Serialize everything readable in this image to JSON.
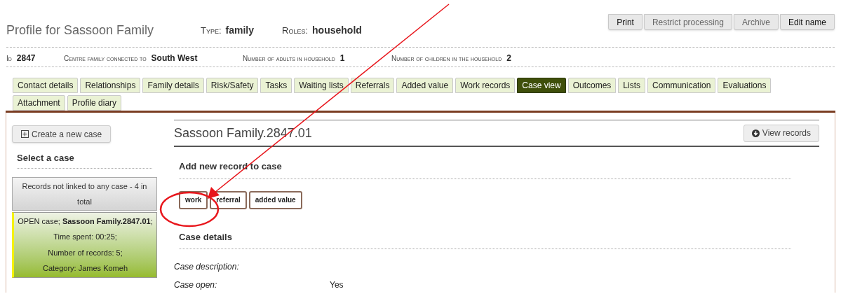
{
  "header": {
    "title": "Profile for Sassoon Family",
    "fields": [
      {
        "label": "Type:",
        "value": "family"
      },
      {
        "label": "Roles:",
        "value": "household"
      }
    ],
    "buttons": [
      {
        "label": "Print",
        "dark": true
      },
      {
        "label": "Restrict processing",
        "dark": false
      },
      {
        "label": "Archive",
        "dark": false
      },
      {
        "label": "Edit name",
        "dark": true
      }
    ]
  },
  "info": [
    {
      "label": "Id",
      "value": "2847"
    },
    {
      "label": "Centre family connected to",
      "value": "South West"
    },
    {
      "label": "Number of adults in household",
      "value": "1"
    },
    {
      "label": "Number of children in the household",
      "value": "2"
    }
  ],
  "tabs": [
    [
      {
        "label": "Contact details",
        "selected": false
      },
      {
        "label": "Relationships",
        "selected": false
      },
      {
        "label": "Family details",
        "selected": false
      },
      {
        "label": "Risk/Safety",
        "selected": false
      },
      {
        "label": "Tasks",
        "selected": false
      },
      {
        "label": "Waiting lists",
        "selected": false
      },
      {
        "label": "Referrals",
        "selected": false
      },
      {
        "label": "Added value",
        "selected": false
      },
      {
        "label": "Work records",
        "selected": false
      },
      {
        "label": "Case view",
        "selected": true
      },
      {
        "label": "Outcomes",
        "selected": false
      },
      {
        "label": "Lists",
        "selected": false
      },
      {
        "label": "Communication",
        "selected": false
      },
      {
        "label": "Evaluations",
        "selected": false
      }
    ],
    [
      {
        "label": "Attachment",
        "selected": false
      },
      {
        "label": "Profile diary",
        "selected": false
      }
    ]
  ],
  "sidebar": {
    "create_button": "Create a new case",
    "heading": "Select a case",
    "cases": [
      {
        "kind": "unlinked",
        "text": "Records not linked to any case - 4 in total"
      },
      {
        "kind": "open",
        "lines": [
          "OPEN case; **Sassoon Family.2847.01**;",
          "Time spent: 00:25;",
          "Number of records: 5;",
          "Category: James Komeh"
        ]
      }
    ]
  },
  "case": {
    "title": "Sassoon Family.2847.01",
    "view_button": "View records",
    "add_heading": "Add new record to case",
    "record_buttons": [
      "work",
      "referral",
      "added value"
    ],
    "details_heading": "Case details",
    "details": [
      {
        "label": "Case description:"
      },
      {
        "label": "Case open:",
        "value": "Yes"
      }
    ]
  },
  "annotation": {
    "kind": "circled_arrow"
  }
}
